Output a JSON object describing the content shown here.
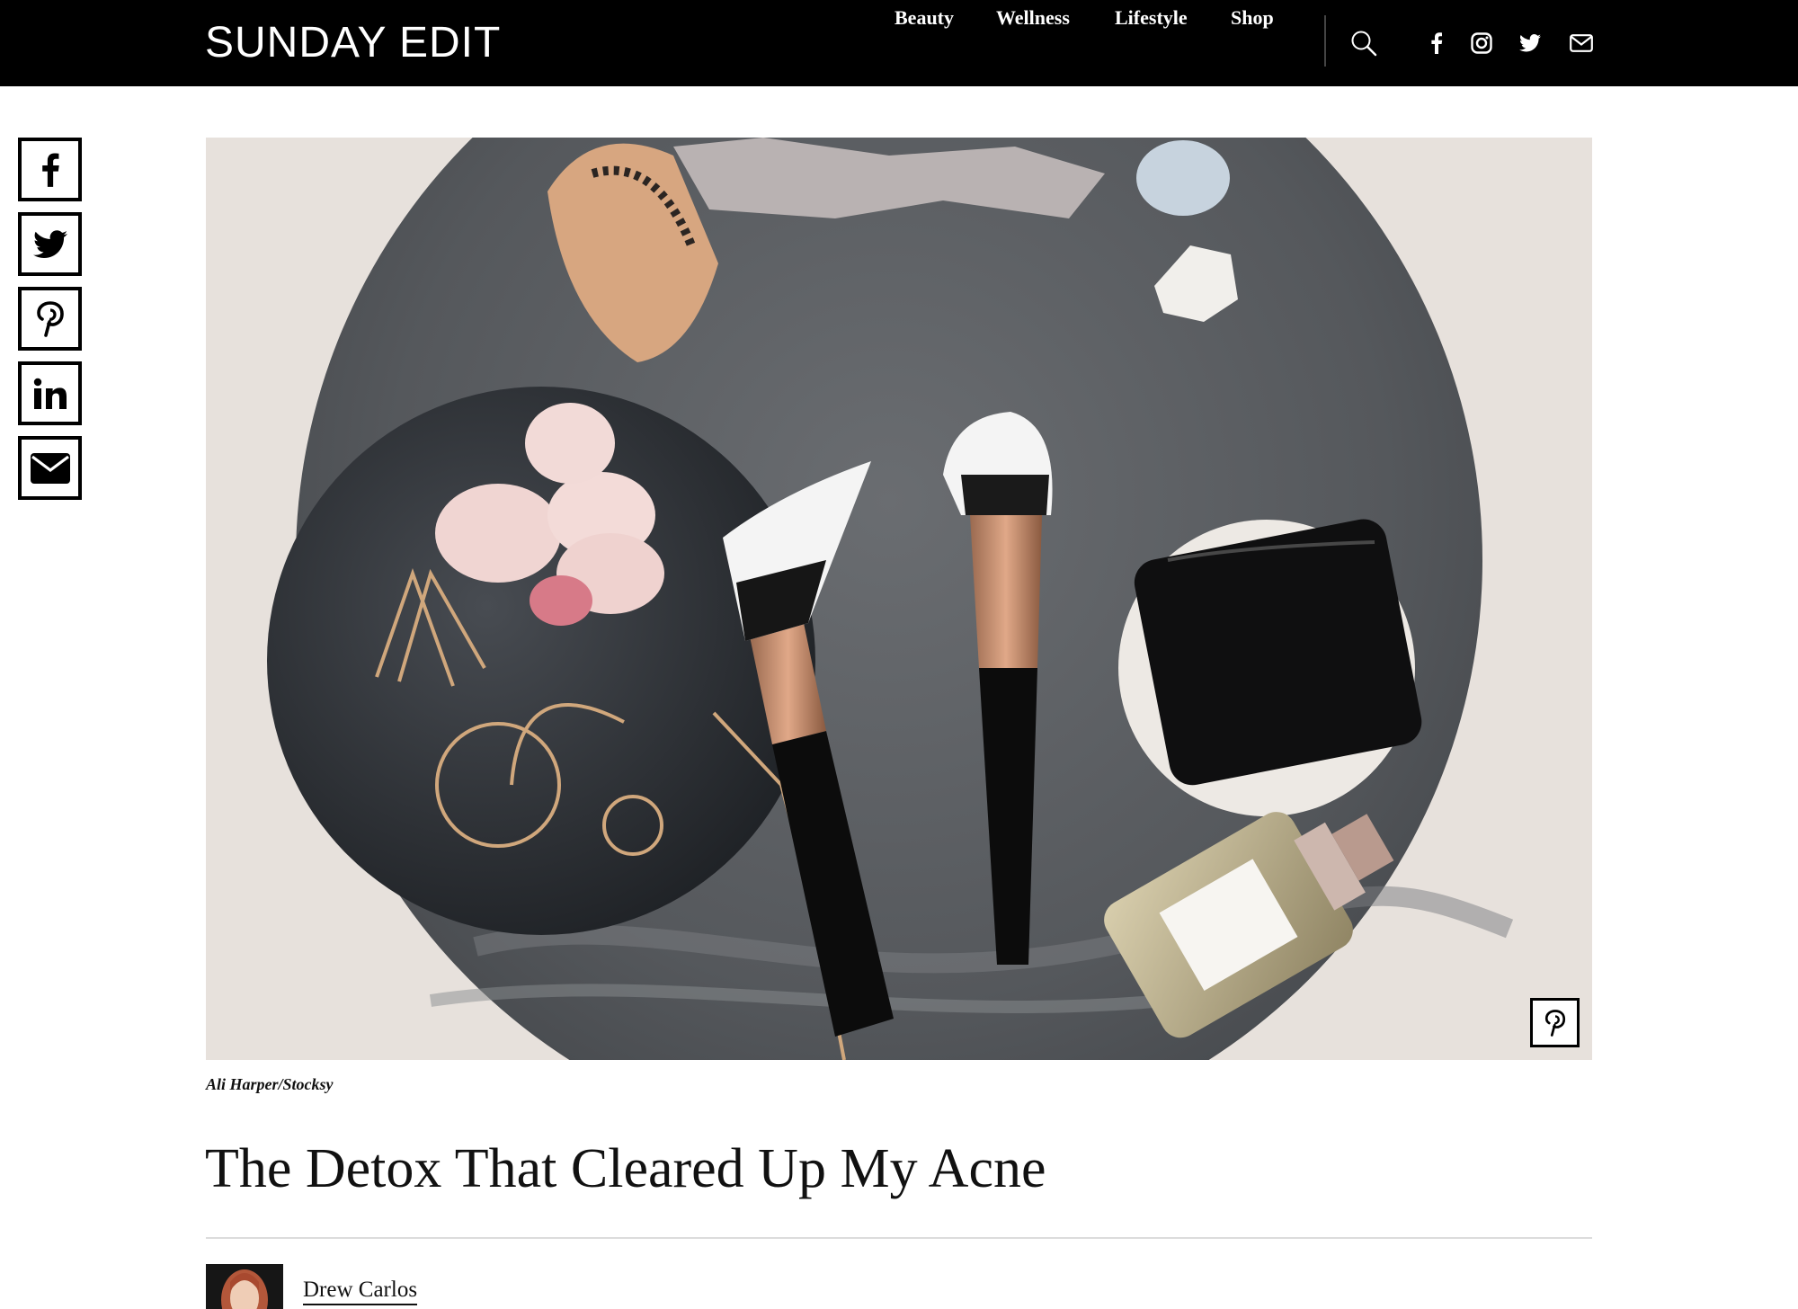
{
  "site": {
    "logo": "SUNDAY EDIT"
  },
  "nav": {
    "items": [
      {
        "label": "Beauty"
      },
      {
        "label": "Wellness"
      },
      {
        "label": "Lifestyle"
      },
      {
        "label": "Shop"
      }
    ]
  },
  "header_icons": [
    "search-icon",
    "facebook-icon",
    "instagram-icon",
    "twitter-icon",
    "mail-icon"
  ],
  "share_rail": [
    "facebook-icon",
    "twitter-icon",
    "pinterest-icon",
    "linkedin-icon",
    "mail-icon"
  ],
  "hero": {
    "photo_credit": "Ali Harper/Stocksy",
    "pin_icon": "pinterest-icon"
  },
  "article": {
    "title": "The Detox That Cleared Up My Acne",
    "author_name": "Drew Carlos"
  },
  "colors": {
    "header_bg": "#000000",
    "page_bg": "#ffffff",
    "text": "#111111",
    "hero_bg": "#e7e1dc",
    "marble": "#5b5e63",
    "rose_gold": "#c98e6e"
  }
}
